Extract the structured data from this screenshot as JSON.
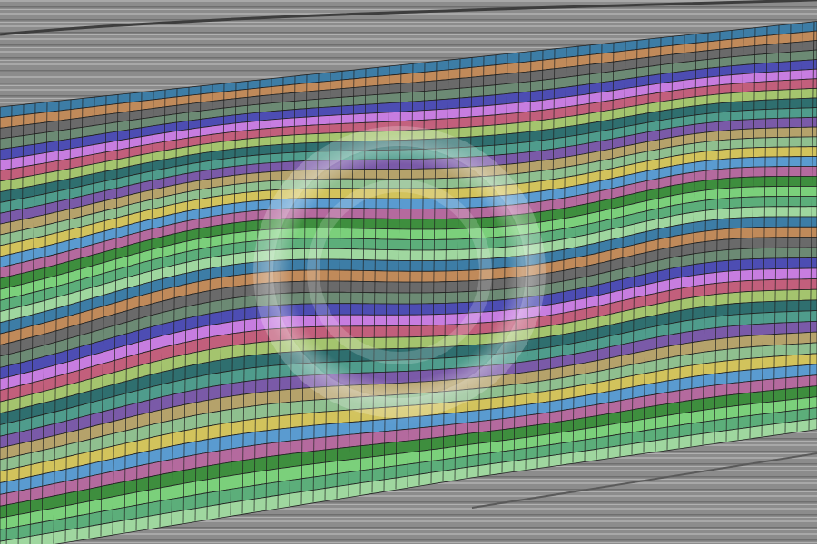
{
  "scene": {
    "description_icon": "geologic-grid-icon",
    "background_color": "#8e8e8e",
    "layer_palette": [
      "#3d7da6",
      "#6c8a74",
      "#c25f7c",
      "#4f9c8c",
      "#8fbf8f",
      "#b46a9e",
      "#5cae7a",
      "#c08a5a",
      "#4d4db3",
      "#a4c46e",
      "#7a5aa8",
      "#d2c35c",
      "#3e8e3e",
      "#9fd79f",
      "#6a6a6a",
      "#c77de0",
      "#2f6f6f",
      "#b5a26b",
      "#5a9bd0",
      "#7bd07b"
    ],
    "layer_count": 40,
    "cell_width": 13,
    "watermark": "circular-watermark-icon"
  }
}
